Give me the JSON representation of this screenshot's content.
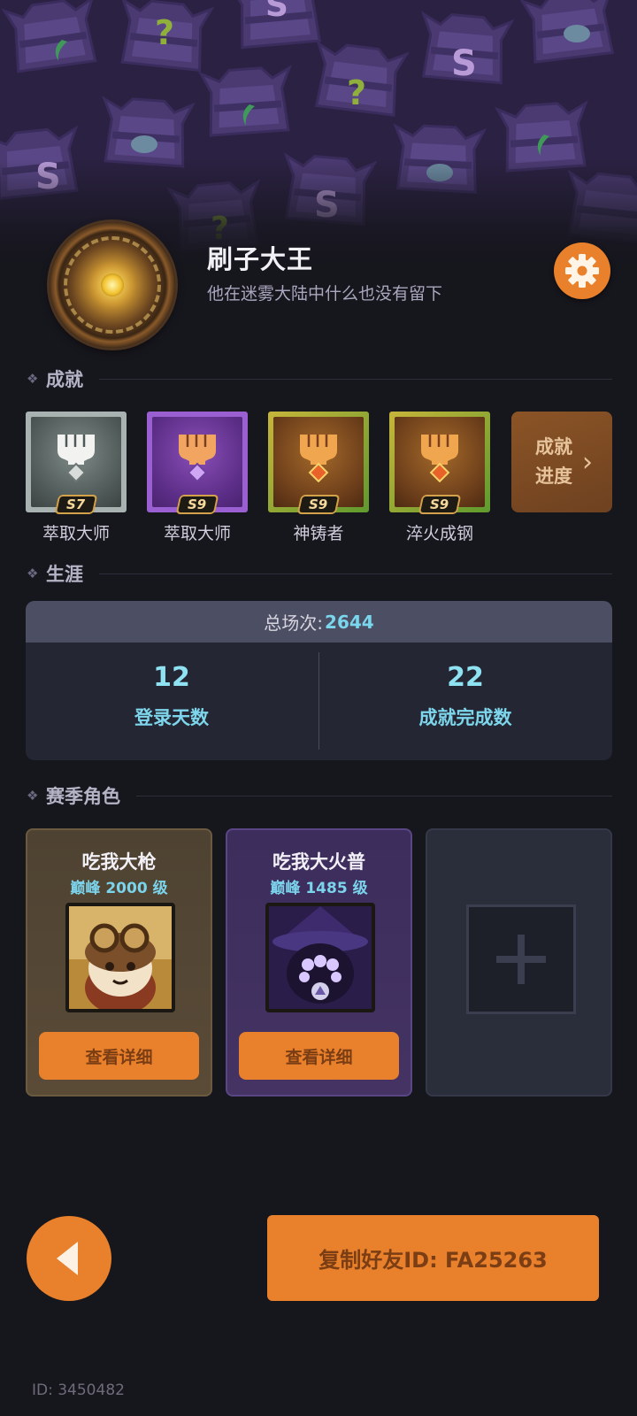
{
  "profile": {
    "name": "刷子大王",
    "subtitle": "他在迷雾大陆中什么也没有留下"
  },
  "sections": {
    "achievements": "成就",
    "career": "生涯",
    "season_characters": "赛季角色"
  },
  "achievements": [
    {
      "label": "萃取大师",
      "season": "S7",
      "tier": "silver"
    },
    {
      "label": "萃取大师",
      "season": "S9",
      "tier": "purple"
    },
    {
      "label": "神铸者",
      "season": "S9",
      "tier": "gold"
    },
    {
      "label": "淬火成钢",
      "season": "S9",
      "tier": "gold"
    }
  ],
  "achievement_progress": {
    "line1": "成就",
    "line2": "进度"
  },
  "career": {
    "total_label": "总场次:",
    "total_value": "2644",
    "stats": [
      {
        "value": "12",
        "label": "登录天数"
      },
      {
        "value": "22",
        "label": "成就完成数"
      }
    ]
  },
  "characters": [
    {
      "name": "吃我大枪",
      "level": "巅峰 2000 级",
      "button": "查看详细"
    },
    {
      "name": "吃我大火普",
      "level": "巅峰 1485 级",
      "button": "查看详细"
    }
  ],
  "copy_button": "复制好友ID: FA25263",
  "user_id": "ID: 3450482",
  "colors": {
    "accent": "#e9802b",
    "background": "#16161d",
    "stat_text": "#7ed6ec"
  },
  "icons": {
    "settings": "gear-icon",
    "back": "triangle-left-icon",
    "add": "plus-icon"
  }
}
